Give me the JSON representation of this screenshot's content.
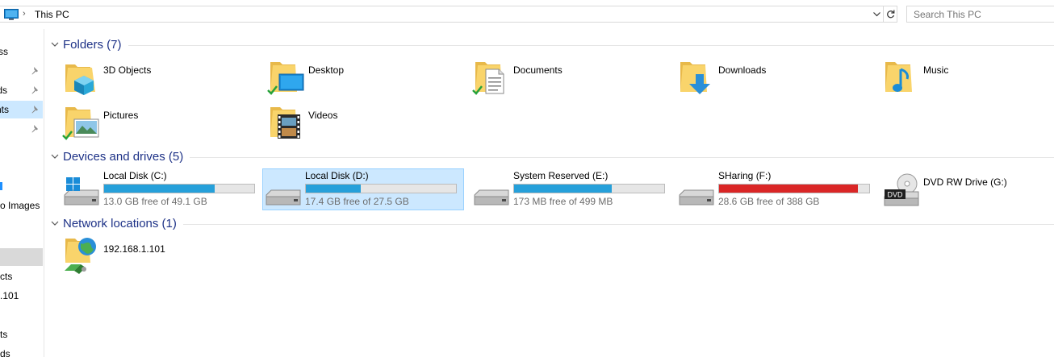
{
  "address_bar": {
    "location": "This PC",
    "separator": "›"
  },
  "search": {
    "placeholder": "Search This PC"
  },
  "nav_pane": {
    "items": [
      {
        "label": "ss",
        "pinned": false,
        "state": "normal"
      },
      {
        "label": "",
        "pinned": true,
        "state": "normal"
      },
      {
        "label": "ds",
        "pinned": true,
        "state": "normal"
      },
      {
        "label": "nts",
        "pinned": true,
        "state": "highlighted"
      },
      {
        "label": "",
        "pinned": true,
        "state": "normal"
      },
      {
        "label": "o Images",
        "pinned": false,
        "state": "normal"
      },
      {
        "label": "",
        "pinned": false,
        "state": "selected"
      },
      {
        "label": "cts",
        "pinned": false,
        "state": "normal"
      },
      {
        "label": ".101",
        "pinned": false,
        "state": "normal"
      },
      {
        "label": "ts",
        "pinned": false,
        "state": "normal"
      },
      {
        "label": "ds",
        "pinned": false,
        "state": "normal"
      }
    ]
  },
  "groups": {
    "folders": {
      "title": "Folders (7)",
      "items": [
        {
          "label": "3D Objects",
          "icon": "3d-objects-folder-icon"
        },
        {
          "label": "Desktop",
          "icon": "desktop-folder-icon"
        },
        {
          "label": "Documents",
          "icon": "documents-folder-icon"
        },
        {
          "label": "Downloads",
          "icon": "downloads-folder-icon"
        },
        {
          "label": "Music",
          "icon": "music-folder-icon"
        },
        {
          "label": "Pictures",
          "icon": "pictures-folder-icon"
        },
        {
          "label": "Videos",
          "icon": "videos-folder-icon"
        }
      ]
    },
    "drives": {
      "title": "Devices and drives (5)",
      "items": [
        {
          "name": "Local Disk (C:)",
          "free_text": "13.0 GB free of 49.1 GB",
          "used_fraction": 0.735,
          "bar_color": "#26a0da",
          "icon": "windows-drive-icon",
          "selected": false
        },
        {
          "name": "Local Disk (D:)",
          "free_text": "17.4 GB free of 27.5 GB",
          "used_fraction": 0.367,
          "bar_color": "#26a0da",
          "icon": "hard-drive-icon",
          "selected": true
        },
        {
          "name": "System Reserved (E:)",
          "free_text": "173 MB free of 499 MB",
          "used_fraction": 0.653,
          "bar_color": "#26a0da",
          "icon": "hard-drive-icon",
          "selected": false
        },
        {
          "name": "SHaring (F:)",
          "free_text": "28.6 GB free of 388 GB",
          "used_fraction": 0.926,
          "bar_color": "#da2626",
          "icon": "hard-drive-icon",
          "selected": false
        },
        {
          "name": "DVD RW Drive (G:)",
          "icon": "dvd-drive-icon",
          "badge": "DVD"
        }
      ]
    },
    "network": {
      "title": "Network locations (1)",
      "items": [
        {
          "label": "192.168.1.101",
          "icon": "network-location-icon"
        }
      ]
    }
  },
  "colors": {
    "group_title": "#1e3287",
    "selection_bg": "#cce8ff",
    "selection_border": "#99d1ff",
    "bar_normal": "#26a0da",
    "bar_full": "#da2626"
  }
}
